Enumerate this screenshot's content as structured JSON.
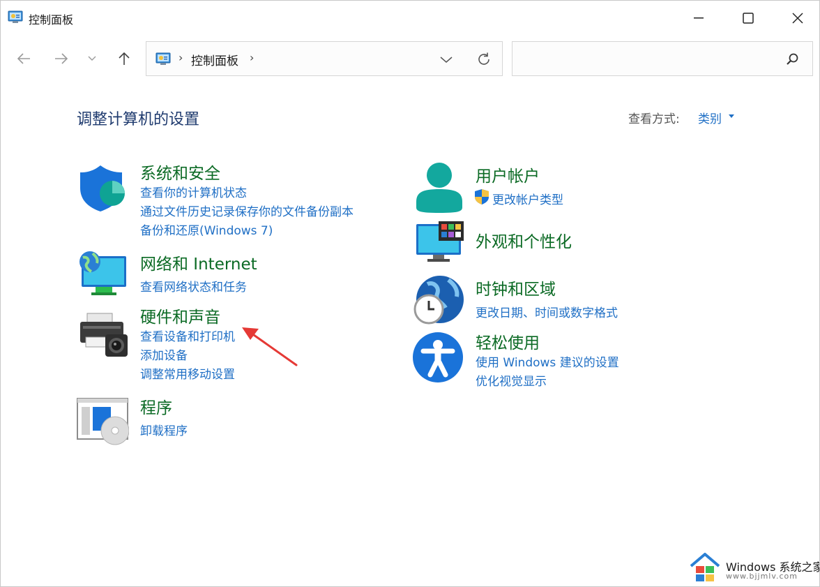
{
  "window": {
    "title": "控制面板"
  },
  "navigation": {
    "breadcrumb": "控制面板",
    "search_placeholder": ""
  },
  "main": {
    "heading": "调整计算机的设置",
    "view_by_label": "查看方式:",
    "view_by_value": "类别",
    "categories": [
      {
        "title": "系统和安全",
        "icon": "shield-pie-icon",
        "links": [
          "查看你的计算机状态",
          "通过文件历史记录保存你的文件备份副本",
          "备份和还原(Windows 7)"
        ]
      },
      {
        "title": "网络和 Internet",
        "icon": "globe-monitor-icon",
        "links": [
          "查看网络状态和任务"
        ]
      },
      {
        "title": "硬件和声音",
        "icon": "printer-camera-icon",
        "links": [
          "查看设备和打印机",
          "添加设备",
          "调整常用移动设置"
        ]
      },
      {
        "title": "程序",
        "icon": "programs-disc-icon",
        "links": [
          "卸载程序"
        ]
      },
      {
        "title": "用户帐户",
        "icon": "user-icon",
        "links": [
          "更改帐户类型"
        ]
      },
      {
        "title": "外观和个性化",
        "icon": "monitor-palette-icon",
        "links": []
      },
      {
        "title": "时钟和区域",
        "icon": "globe-clock-icon",
        "links": [
          "更改日期、时间或数字格式"
        ]
      },
      {
        "title": "轻松使用",
        "icon": "accessibility-icon",
        "links": [
          "使用 Windows 建议的设置",
          "优化视觉显示"
        ]
      }
    ]
  },
  "watermark": {
    "line1": "Windows 系统之家",
    "line2": "www.bjjmlv.com"
  },
  "colors": {
    "category_title": "#0b6a24",
    "link": "#1f6fc5",
    "heading": "#1e3a6e",
    "annotation_arrow": "#e53935"
  }
}
